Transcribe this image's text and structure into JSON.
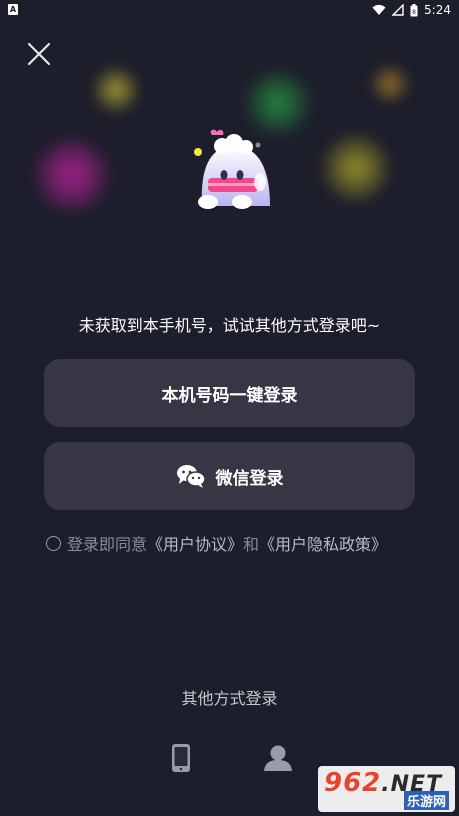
{
  "status_bar": {
    "app_icon_letter": "A",
    "time": "5:24",
    "battery_level": "8"
  },
  "hint_text": "未获取到本手机号，试试其他方式登录吧~",
  "buttons": {
    "phone_login": "本机号码一键登录",
    "wechat_login": "微信登录"
  },
  "agreement": {
    "prefix": "登录即同意",
    "user_agreement": "《用户协议》",
    "and": "和",
    "privacy_policy": "《用户隐私政策》",
    "checked": false
  },
  "other_methods": {
    "title": "其他方式登录",
    "options": [
      {
        "icon": "mobile-phone-icon"
      },
      {
        "icon": "user-account-icon"
      }
    ]
  },
  "watermark": {
    "main": "962",
    "suffix": ".NET",
    "sub": "乐游网"
  },
  "colors": {
    "background": "#1d1e2b",
    "button": "#363645",
    "muted_text": "#8a8b98"
  }
}
